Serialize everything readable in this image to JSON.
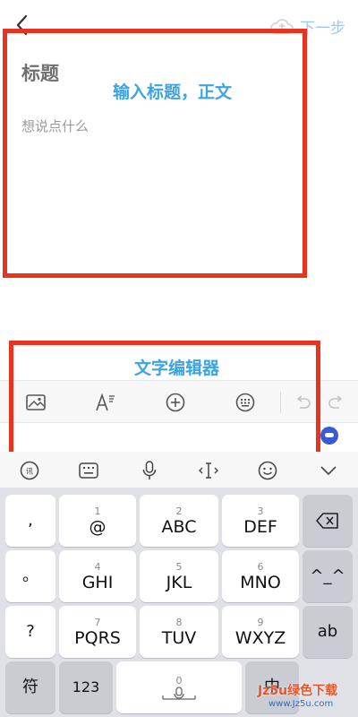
{
  "header": {
    "next_label": "下一步"
  },
  "editor": {
    "title_placeholder": "标题",
    "body_placeholder": "想说点什么"
  },
  "annotations": {
    "box1_label": "输入标题，正文",
    "box2_label": "文字编辑器"
  },
  "toolbar": {
    "icons": [
      "image-icon",
      "text-format-icon",
      "add-icon",
      "keyboard-icon",
      "undo-icon",
      "redo-icon"
    ]
  },
  "ime_bar": {
    "icons": [
      "ime-logo-icon",
      "keyboard-layout-icon",
      "microphone-icon",
      "cursor-move-icon",
      "emoji-icon",
      "collapse-chevron-icon"
    ]
  },
  "keyboard": {
    "left_column": [
      ",",
      "。",
      "?",
      "!"
    ],
    "keys": [
      {
        "num": "1",
        "main": "@"
      },
      {
        "num": "2",
        "main": "ABC"
      },
      {
        "num": "3",
        "main": "DEF"
      },
      {
        "num": "4",
        "main": "GHI"
      },
      {
        "num": "5",
        "main": "JKL"
      },
      {
        "num": "6",
        "main": "MNO"
      },
      {
        "num": "7",
        "main": "PQRS"
      },
      {
        "num": "8",
        "main": "TUV"
      },
      {
        "num": "9",
        "main": "WXYZ"
      },
      {
        "num": "0",
        "main": ""
      }
    ],
    "emoticon": "^_^",
    "ab": "ab",
    "symbol": "符",
    "numbers": "123",
    "lang": "中"
  },
  "watermark": {
    "main": "Jz5u绿色下载",
    "sub": "www.Jz5u.com"
  },
  "colors": {
    "annotation_border": "#e8341f",
    "annotation_text": "#3da4e0",
    "next_button": "#9ec9f0"
  }
}
